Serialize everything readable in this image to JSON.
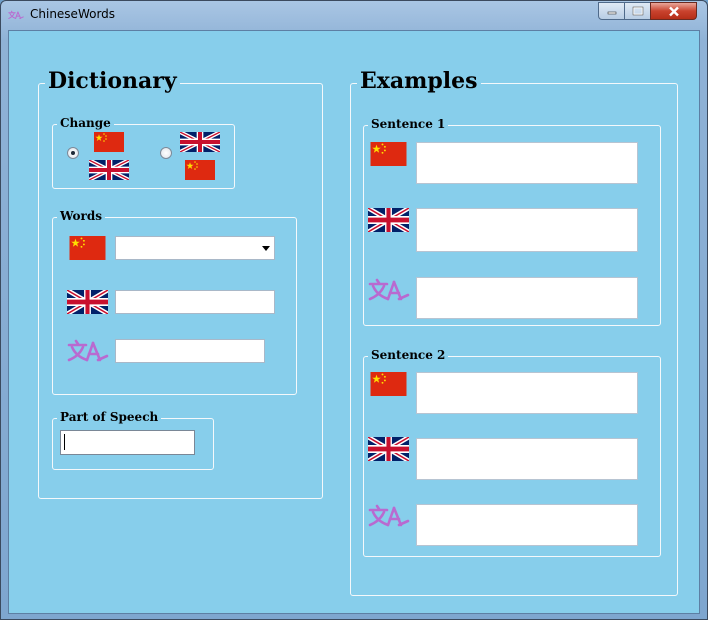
{
  "window": {
    "title": "ChineseWords"
  },
  "dictionary": {
    "heading": "Dictionary",
    "change": {
      "label": "Change",
      "selected_option": 1
    },
    "words": {
      "label": "Words",
      "chinese_value": "",
      "english_value": "",
      "pinyin_value": ""
    },
    "part_of_speech": {
      "label": "Part of Speech",
      "value": ""
    }
  },
  "examples": {
    "heading": "Examples",
    "sentence1": {
      "label": "Sentence 1"
    },
    "sentence2": {
      "label": "Sentence 2"
    }
  },
  "icons": {
    "china_flag": "china-flag-icon",
    "uk_flag": "uk-flag-icon",
    "translate": "translate-icon"
  },
  "colors": {
    "client_background": "#87ceeb",
    "china_red": "#de2910",
    "china_star": "#ffde00",
    "translate_purple": "#b96ad0"
  }
}
